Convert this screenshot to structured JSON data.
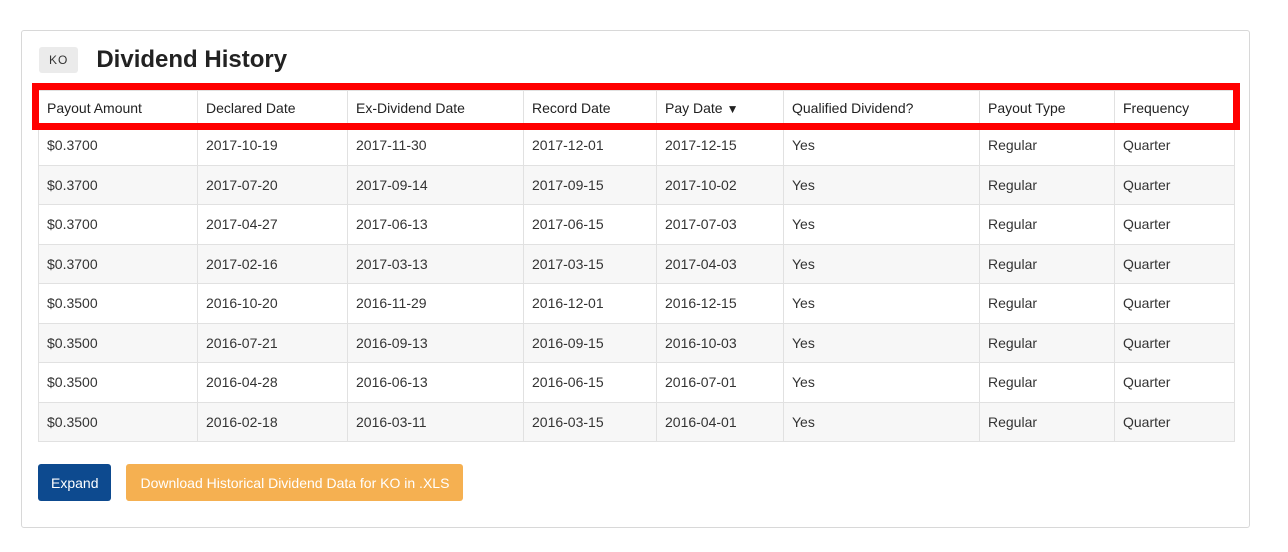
{
  "header": {
    "ticker": "KO",
    "title": "Dividend History"
  },
  "table": {
    "columns": [
      "Payout Amount",
      "Declared Date",
      "Ex-Dividend Date",
      "Record Date",
      "Pay Date",
      "Qualified Dividend?",
      "Payout Type",
      "Frequency"
    ],
    "sort_indicator": "▼",
    "rows": [
      [
        "$0.3700",
        "2017-10-19",
        "2017-11-30",
        "2017-12-01",
        "2017-12-15",
        "Yes",
        "Regular",
        "Quarter"
      ],
      [
        "$0.3700",
        "2017-07-20",
        "2017-09-14",
        "2017-09-15",
        "2017-10-02",
        "Yes",
        "Regular",
        "Quarter"
      ],
      [
        "$0.3700",
        "2017-04-27",
        "2017-06-13",
        "2017-06-15",
        "2017-07-03",
        "Yes",
        "Regular",
        "Quarter"
      ],
      [
        "$0.3700",
        "2017-02-16",
        "2017-03-13",
        "2017-03-15",
        "2017-04-03",
        "Yes",
        "Regular",
        "Quarter"
      ],
      [
        "$0.3500",
        "2016-10-20",
        "2016-11-29",
        "2016-12-01",
        "2016-12-15",
        "Yes",
        "Regular",
        "Quarter"
      ],
      [
        "$0.3500",
        "2016-07-21",
        "2016-09-13",
        "2016-09-15",
        "2016-10-03",
        "Yes",
        "Regular",
        "Quarter"
      ],
      [
        "$0.3500",
        "2016-04-28",
        "2016-06-13",
        "2016-06-15",
        "2016-07-01",
        "Yes",
        "Regular",
        "Quarter"
      ],
      [
        "$0.3500",
        "2016-02-18",
        "2016-03-11",
        "2016-03-15",
        "2016-04-01",
        "Yes",
        "Regular",
        "Quarter"
      ]
    ]
  },
  "actions": {
    "expand_label": "Expand",
    "download_label": "Download Historical Dividend Data for KO in .XLS"
  },
  "colors": {
    "expand_button": "#0d4a8f",
    "download_button": "#f5b051",
    "highlight": "#ff0000"
  }
}
